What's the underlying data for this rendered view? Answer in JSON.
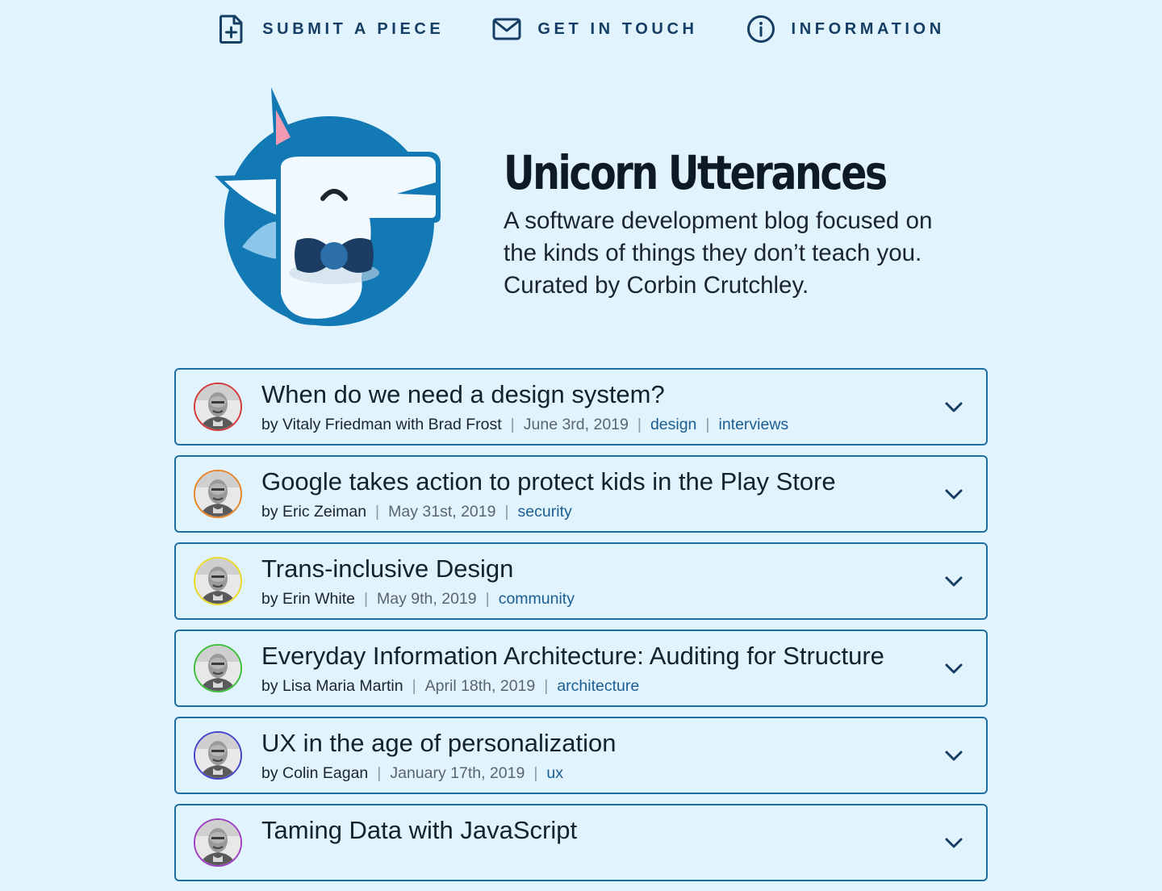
{
  "nav": {
    "items": [
      {
        "label": "SUBMIT A PIECE",
        "icon": "file-plus-icon"
      },
      {
        "label": "GET IN TOUCH",
        "icon": "envelope-icon"
      },
      {
        "label": "INFORMATION",
        "icon": "info-icon"
      }
    ]
  },
  "hero": {
    "title": "Unicorn Utterances",
    "description": "A software development blog focused on the kinds of things they don’t teach you. Curated by Corbin Crutchley."
  },
  "colors": {
    "background": "#e1f3fd",
    "accent": "#1d6fa3",
    "tag": "#1b5d92"
  },
  "posts": [
    {
      "title": "When do we need a design system?",
      "author": "by Vitaly Friedman with Brad Frost",
      "date": "June 3rd, 2019",
      "tags": [
        "design",
        "interviews"
      ],
      "ring_color": "#d23a3a"
    },
    {
      "title": "Google takes action to protect kids in the Play Store",
      "author": "by Eric Zeiman",
      "date": "May 31st, 2019",
      "tags": [
        "security"
      ],
      "ring_color": "#e8852a"
    },
    {
      "title": "Trans-inclusive Design",
      "author": "by Erin White",
      "date": "May 9th, 2019",
      "tags": [
        "community"
      ],
      "ring_color": "#e8d92a"
    },
    {
      "title": "Everyday Information Architecture: Auditing for Structure",
      "author": "by Lisa Maria Martin",
      "date": "April 18th, 2019",
      "tags": [
        "architecture"
      ],
      "ring_color": "#3cbf3c"
    },
    {
      "title": "UX in the age of personalization",
      "author": "by Colin Eagan",
      "date": "January 17th, 2019",
      "tags": [
        "ux"
      ],
      "ring_color": "#4444cc"
    },
    {
      "title": "Taming Data with JavaScript",
      "author": "",
      "date": "",
      "tags": [],
      "ring_color": "#a040c0"
    }
  ]
}
